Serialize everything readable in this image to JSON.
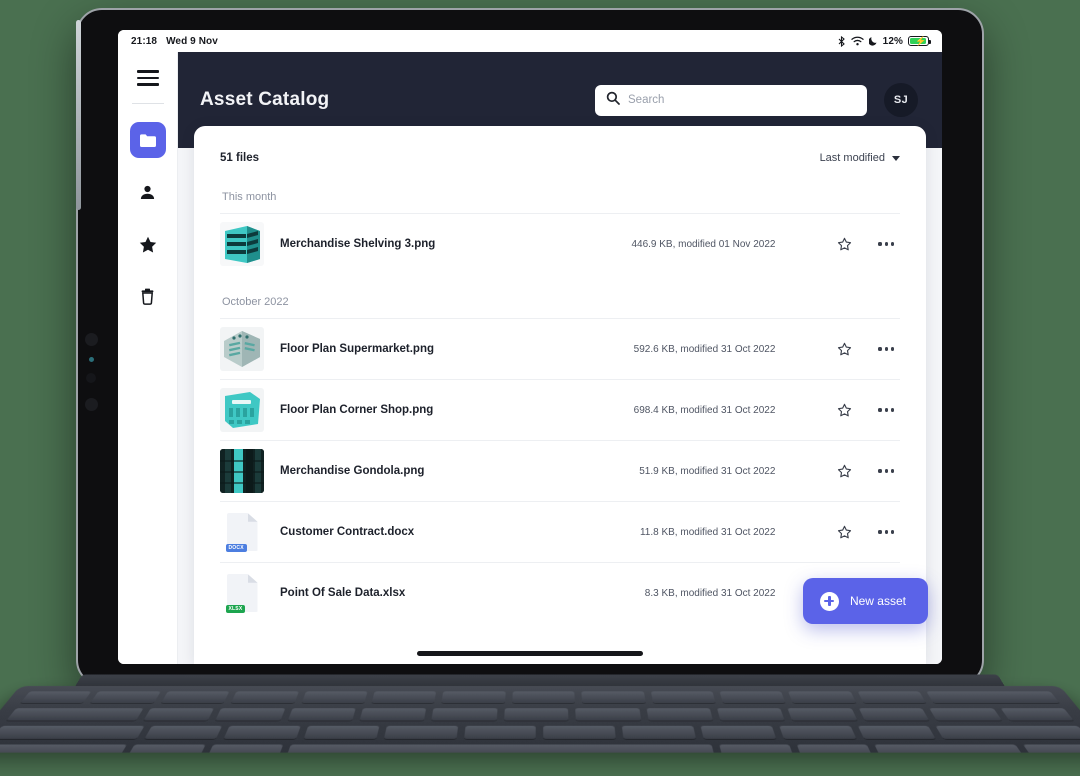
{
  "status_bar": {
    "time": "21:18",
    "date": "Wed 9 Nov",
    "battery_percent": "12%",
    "icons": [
      "bluetooth-icon",
      "wifi-icon",
      "do-not-disturb-icon",
      "battery-charging-icon"
    ]
  },
  "sidebar": {
    "menu_icon": "hamburger-menu-icon",
    "items": [
      {
        "name": "folder",
        "icon": "folder-icon",
        "active": true
      },
      {
        "name": "people",
        "icon": "person-icon",
        "active": false
      },
      {
        "name": "starred",
        "icon": "star-icon",
        "active": false
      },
      {
        "name": "trash",
        "icon": "trash-icon",
        "active": false
      }
    ]
  },
  "header": {
    "title": "Asset Catalog",
    "search": {
      "placeholder": "Search",
      "value": "",
      "icon": "search-icon"
    },
    "avatar": {
      "initials": "SJ"
    }
  },
  "toolbar": {
    "file_count": "51 files",
    "sort_label": "Last modified",
    "sort_icon": "chevron-down-icon"
  },
  "colors": {
    "accent": "#5b63e8",
    "header_bg": "#212536",
    "page_bg": "#4a7050",
    "thumb_teal": "#3fc8c4",
    "docx_badge": "#4c7ee0",
    "xlsx_badge": "#1da54f"
  },
  "sections": [
    {
      "label": "This month",
      "files": [
        {
          "name": "Merchandise Shelving 3.png",
          "meta": "446.9 KB, modified 01 Nov 2022",
          "thumb_type": "image-shelving",
          "star_icon": "star-outline-icon",
          "more_icon": "more-options-icon"
        }
      ]
    },
    {
      "label": "October 2022",
      "files": [
        {
          "name": "Floor Plan Supermarket.png",
          "meta": "592.6 KB, modified 31 Oct 2022",
          "thumb_type": "image-floorplan-supermarket",
          "star_icon": "star-outline-icon",
          "more_icon": "more-options-icon"
        },
        {
          "name": "Floor Plan Corner Shop.png",
          "meta": "698.4 KB, modified 31 Oct 2022",
          "thumb_type": "image-floorplan-corner",
          "star_icon": "star-outline-icon",
          "more_icon": "more-options-icon"
        },
        {
          "name": "Merchandise Gondola.png",
          "meta": "51.9 KB, modified 31 Oct 2022",
          "thumb_type": "image-gondola",
          "star_icon": "star-outline-icon",
          "more_icon": "more-options-icon"
        },
        {
          "name": "Customer Contract.docx",
          "meta": "11.8 KB, modified 31 Oct 2022",
          "thumb_type": "doc",
          "badge": "DOCX",
          "star_icon": "star-outline-icon",
          "more_icon": "more-options-icon"
        },
        {
          "name": "Point Of Sale Data.xlsx",
          "meta": "8.3 KB, modified 31 Oct 2022",
          "thumb_type": "doc",
          "badge": "XLSX",
          "star_icon": "star-outline-icon",
          "more_icon": "more-options-icon"
        }
      ]
    }
  ],
  "fab": {
    "label": "New asset",
    "icon": "plus-circle-icon"
  }
}
